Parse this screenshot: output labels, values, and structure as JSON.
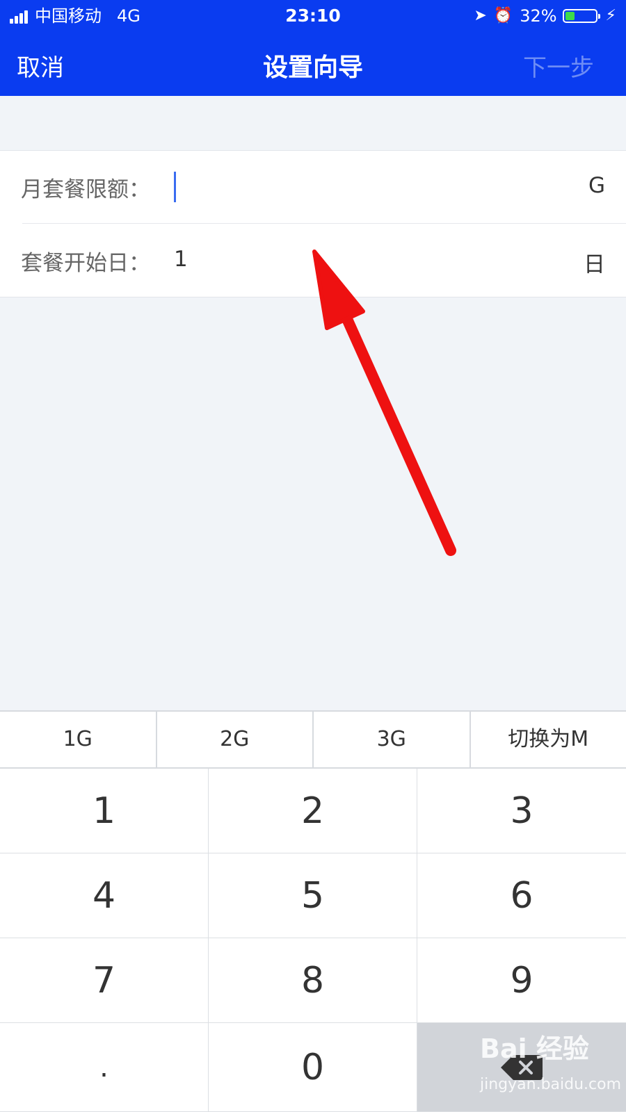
{
  "status_bar": {
    "carrier": "中国移动",
    "network": "4G",
    "time": "23:10",
    "battery": "32%"
  },
  "nav": {
    "cancel": "取消",
    "title": "设置向导",
    "next": "下一步"
  },
  "form": {
    "quota_label": "月套餐限额：",
    "quota_unit": "G",
    "start_label": "套餐开始日：",
    "start_value": "1",
    "start_unit": "日"
  },
  "quick_options": [
    "1G",
    "2G",
    "3G",
    "切换为M"
  ],
  "keypad": [
    "1",
    "2",
    "3",
    "4",
    "5",
    "6",
    "7",
    "8",
    "9",
    ".",
    "0"
  ],
  "watermark": {
    "logo": "Bai 经验",
    "url": "jingyan.baidu.com"
  },
  "colors": {
    "header_bg": "#0a3cf0",
    "annotation_arrow": "#ee1111"
  }
}
